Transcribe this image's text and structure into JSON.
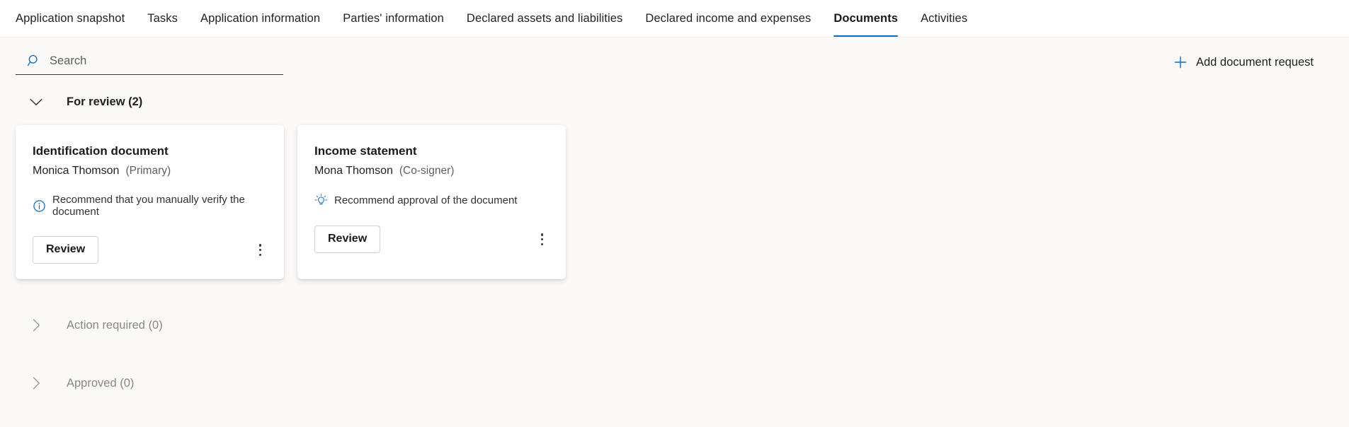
{
  "nav": {
    "tabs": [
      {
        "label": "Application snapshot",
        "active": false
      },
      {
        "label": "Tasks",
        "active": false
      },
      {
        "label": "Application information",
        "active": false
      },
      {
        "label": "Parties' information",
        "active": false
      },
      {
        "label": "Declared assets and liabilities",
        "active": false
      },
      {
        "label": "Declared income and expenses",
        "active": false
      },
      {
        "label": "Documents",
        "active": true
      },
      {
        "label": "Activities",
        "active": false
      }
    ]
  },
  "toolbar": {
    "search_placeholder": "Search",
    "search_value": "",
    "search_icon": "search-icon",
    "add_label": "Add document request",
    "add_icon": "plus-icon"
  },
  "sections": [
    {
      "title": "For review (2)",
      "expanded": true,
      "count": 2,
      "chevron": "chevron-down-icon"
    },
    {
      "title": "Action required (0)",
      "expanded": false,
      "count": 0,
      "chevron": "chevron-right-icon"
    },
    {
      "title": "Approved (0)",
      "expanded": false,
      "count": 0,
      "chevron": "chevron-right-icon"
    }
  ],
  "cards": [
    {
      "title": "Identification document",
      "person": "Monica Thomson",
      "role": "(Primary)",
      "note": "Recommend that you manually verify the document",
      "note_icon": "info-icon",
      "action_label": "Review",
      "menu_icon": "more-vertical-icon"
    },
    {
      "title": "Income statement",
      "person": "Mona Thomson",
      "role": "(Co-signer)",
      "note": "Recommend approval of the document",
      "note_icon": "lightbulb-icon",
      "action_label": "Review",
      "menu_icon": "more-vertical-icon"
    }
  ],
  "colors": {
    "accent": "#0f6cbd",
    "page_bg": "#faf9f8",
    "card_bg": "#ffffff",
    "text": "#201f1e",
    "muted_text": "#8a8886"
  }
}
